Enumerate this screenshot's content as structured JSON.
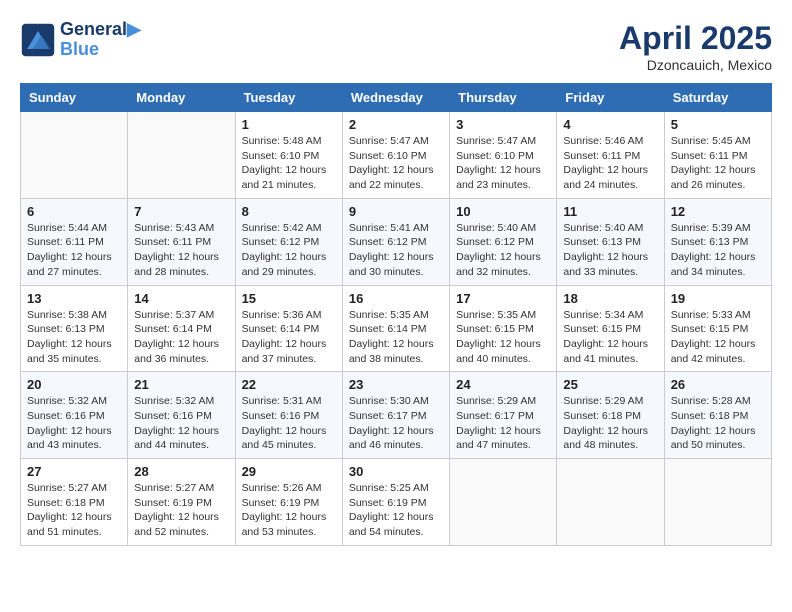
{
  "header": {
    "logo_line1": "General",
    "logo_line2": "Blue",
    "month": "April 2025",
    "location": "Dzoncauich, Mexico"
  },
  "weekdays": [
    "Sunday",
    "Monday",
    "Tuesday",
    "Wednesday",
    "Thursday",
    "Friday",
    "Saturday"
  ],
  "weeks": [
    [
      {
        "day": null
      },
      {
        "day": null
      },
      {
        "day": "1",
        "sunrise": "5:48 AM",
        "sunset": "6:10 PM",
        "daylight": "12 hours and 21 minutes."
      },
      {
        "day": "2",
        "sunrise": "5:47 AM",
        "sunset": "6:10 PM",
        "daylight": "12 hours and 22 minutes."
      },
      {
        "day": "3",
        "sunrise": "5:47 AM",
        "sunset": "6:10 PM",
        "daylight": "12 hours and 23 minutes."
      },
      {
        "day": "4",
        "sunrise": "5:46 AM",
        "sunset": "6:11 PM",
        "daylight": "12 hours and 24 minutes."
      },
      {
        "day": "5",
        "sunrise": "5:45 AM",
        "sunset": "6:11 PM",
        "daylight": "12 hours and 26 minutes."
      }
    ],
    [
      {
        "day": "6",
        "sunrise": "5:44 AM",
        "sunset": "6:11 PM",
        "daylight": "12 hours and 27 minutes."
      },
      {
        "day": "7",
        "sunrise": "5:43 AM",
        "sunset": "6:11 PM",
        "daylight": "12 hours and 28 minutes."
      },
      {
        "day": "8",
        "sunrise": "5:42 AM",
        "sunset": "6:12 PM",
        "daylight": "12 hours and 29 minutes."
      },
      {
        "day": "9",
        "sunrise": "5:41 AM",
        "sunset": "6:12 PM",
        "daylight": "12 hours and 30 minutes."
      },
      {
        "day": "10",
        "sunrise": "5:40 AM",
        "sunset": "6:12 PM",
        "daylight": "12 hours and 32 minutes."
      },
      {
        "day": "11",
        "sunrise": "5:40 AM",
        "sunset": "6:13 PM",
        "daylight": "12 hours and 33 minutes."
      },
      {
        "day": "12",
        "sunrise": "5:39 AM",
        "sunset": "6:13 PM",
        "daylight": "12 hours and 34 minutes."
      }
    ],
    [
      {
        "day": "13",
        "sunrise": "5:38 AM",
        "sunset": "6:13 PM",
        "daylight": "12 hours and 35 minutes."
      },
      {
        "day": "14",
        "sunrise": "5:37 AM",
        "sunset": "6:14 PM",
        "daylight": "12 hours and 36 minutes."
      },
      {
        "day": "15",
        "sunrise": "5:36 AM",
        "sunset": "6:14 PM",
        "daylight": "12 hours and 37 minutes."
      },
      {
        "day": "16",
        "sunrise": "5:35 AM",
        "sunset": "6:14 PM",
        "daylight": "12 hours and 38 minutes."
      },
      {
        "day": "17",
        "sunrise": "5:35 AM",
        "sunset": "6:15 PM",
        "daylight": "12 hours and 40 minutes."
      },
      {
        "day": "18",
        "sunrise": "5:34 AM",
        "sunset": "6:15 PM",
        "daylight": "12 hours and 41 minutes."
      },
      {
        "day": "19",
        "sunrise": "5:33 AM",
        "sunset": "6:15 PM",
        "daylight": "12 hours and 42 minutes."
      }
    ],
    [
      {
        "day": "20",
        "sunrise": "5:32 AM",
        "sunset": "6:16 PM",
        "daylight": "12 hours and 43 minutes."
      },
      {
        "day": "21",
        "sunrise": "5:32 AM",
        "sunset": "6:16 PM",
        "daylight": "12 hours and 44 minutes."
      },
      {
        "day": "22",
        "sunrise": "5:31 AM",
        "sunset": "6:16 PM",
        "daylight": "12 hours and 45 minutes."
      },
      {
        "day": "23",
        "sunrise": "5:30 AM",
        "sunset": "6:17 PM",
        "daylight": "12 hours and 46 minutes."
      },
      {
        "day": "24",
        "sunrise": "5:29 AM",
        "sunset": "6:17 PM",
        "daylight": "12 hours and 47 minutes."
      },
      {
        "day": "25",
        "sunrise": "5:29 AM",
        "sunset": "6:18 PM",
        "daylight": "12 hours and 48 minutes."
      },
      {
        "day": "26",
        "sunrise": "5:28 AM",
        "sunset": "6:18 PM",
        "daylight": "12 hours and 50 minutes."
      }
    ],
    [
      {
        "day": "27",
        "sunrise": "5:27 AM",
        "sunset": "6:18 PM",
        "daylight": "12 hours and 51 minutes."
      },
      {
        "day": "28",
        "sunrise": "5:27 AM",
        "sunset": "6:19 PM",
        "daylight": "12 hours and 52 minutes."
      },
      {
        "day": "29",
        "sunrise": "5:26 AM",
        "sunset": "6:19 PM",
        "daylight": "12 hours and 53 minutes."
      },
      {
        "day": "30",
        "sunrise": "5:25 AM",
        "sunset": "6:19 PM",
        "daylight": "12 hours and 54 minutes."
      },
      {
        "day": null
      },
      {
        "day": null
      },
      {
        "day": null
      }
    ]
  ],
  "labels": {
    "sunrise": "Sunrise:",
    "sunset": "Sunset:",
    "daylight": "Daylight:"
  }
}
